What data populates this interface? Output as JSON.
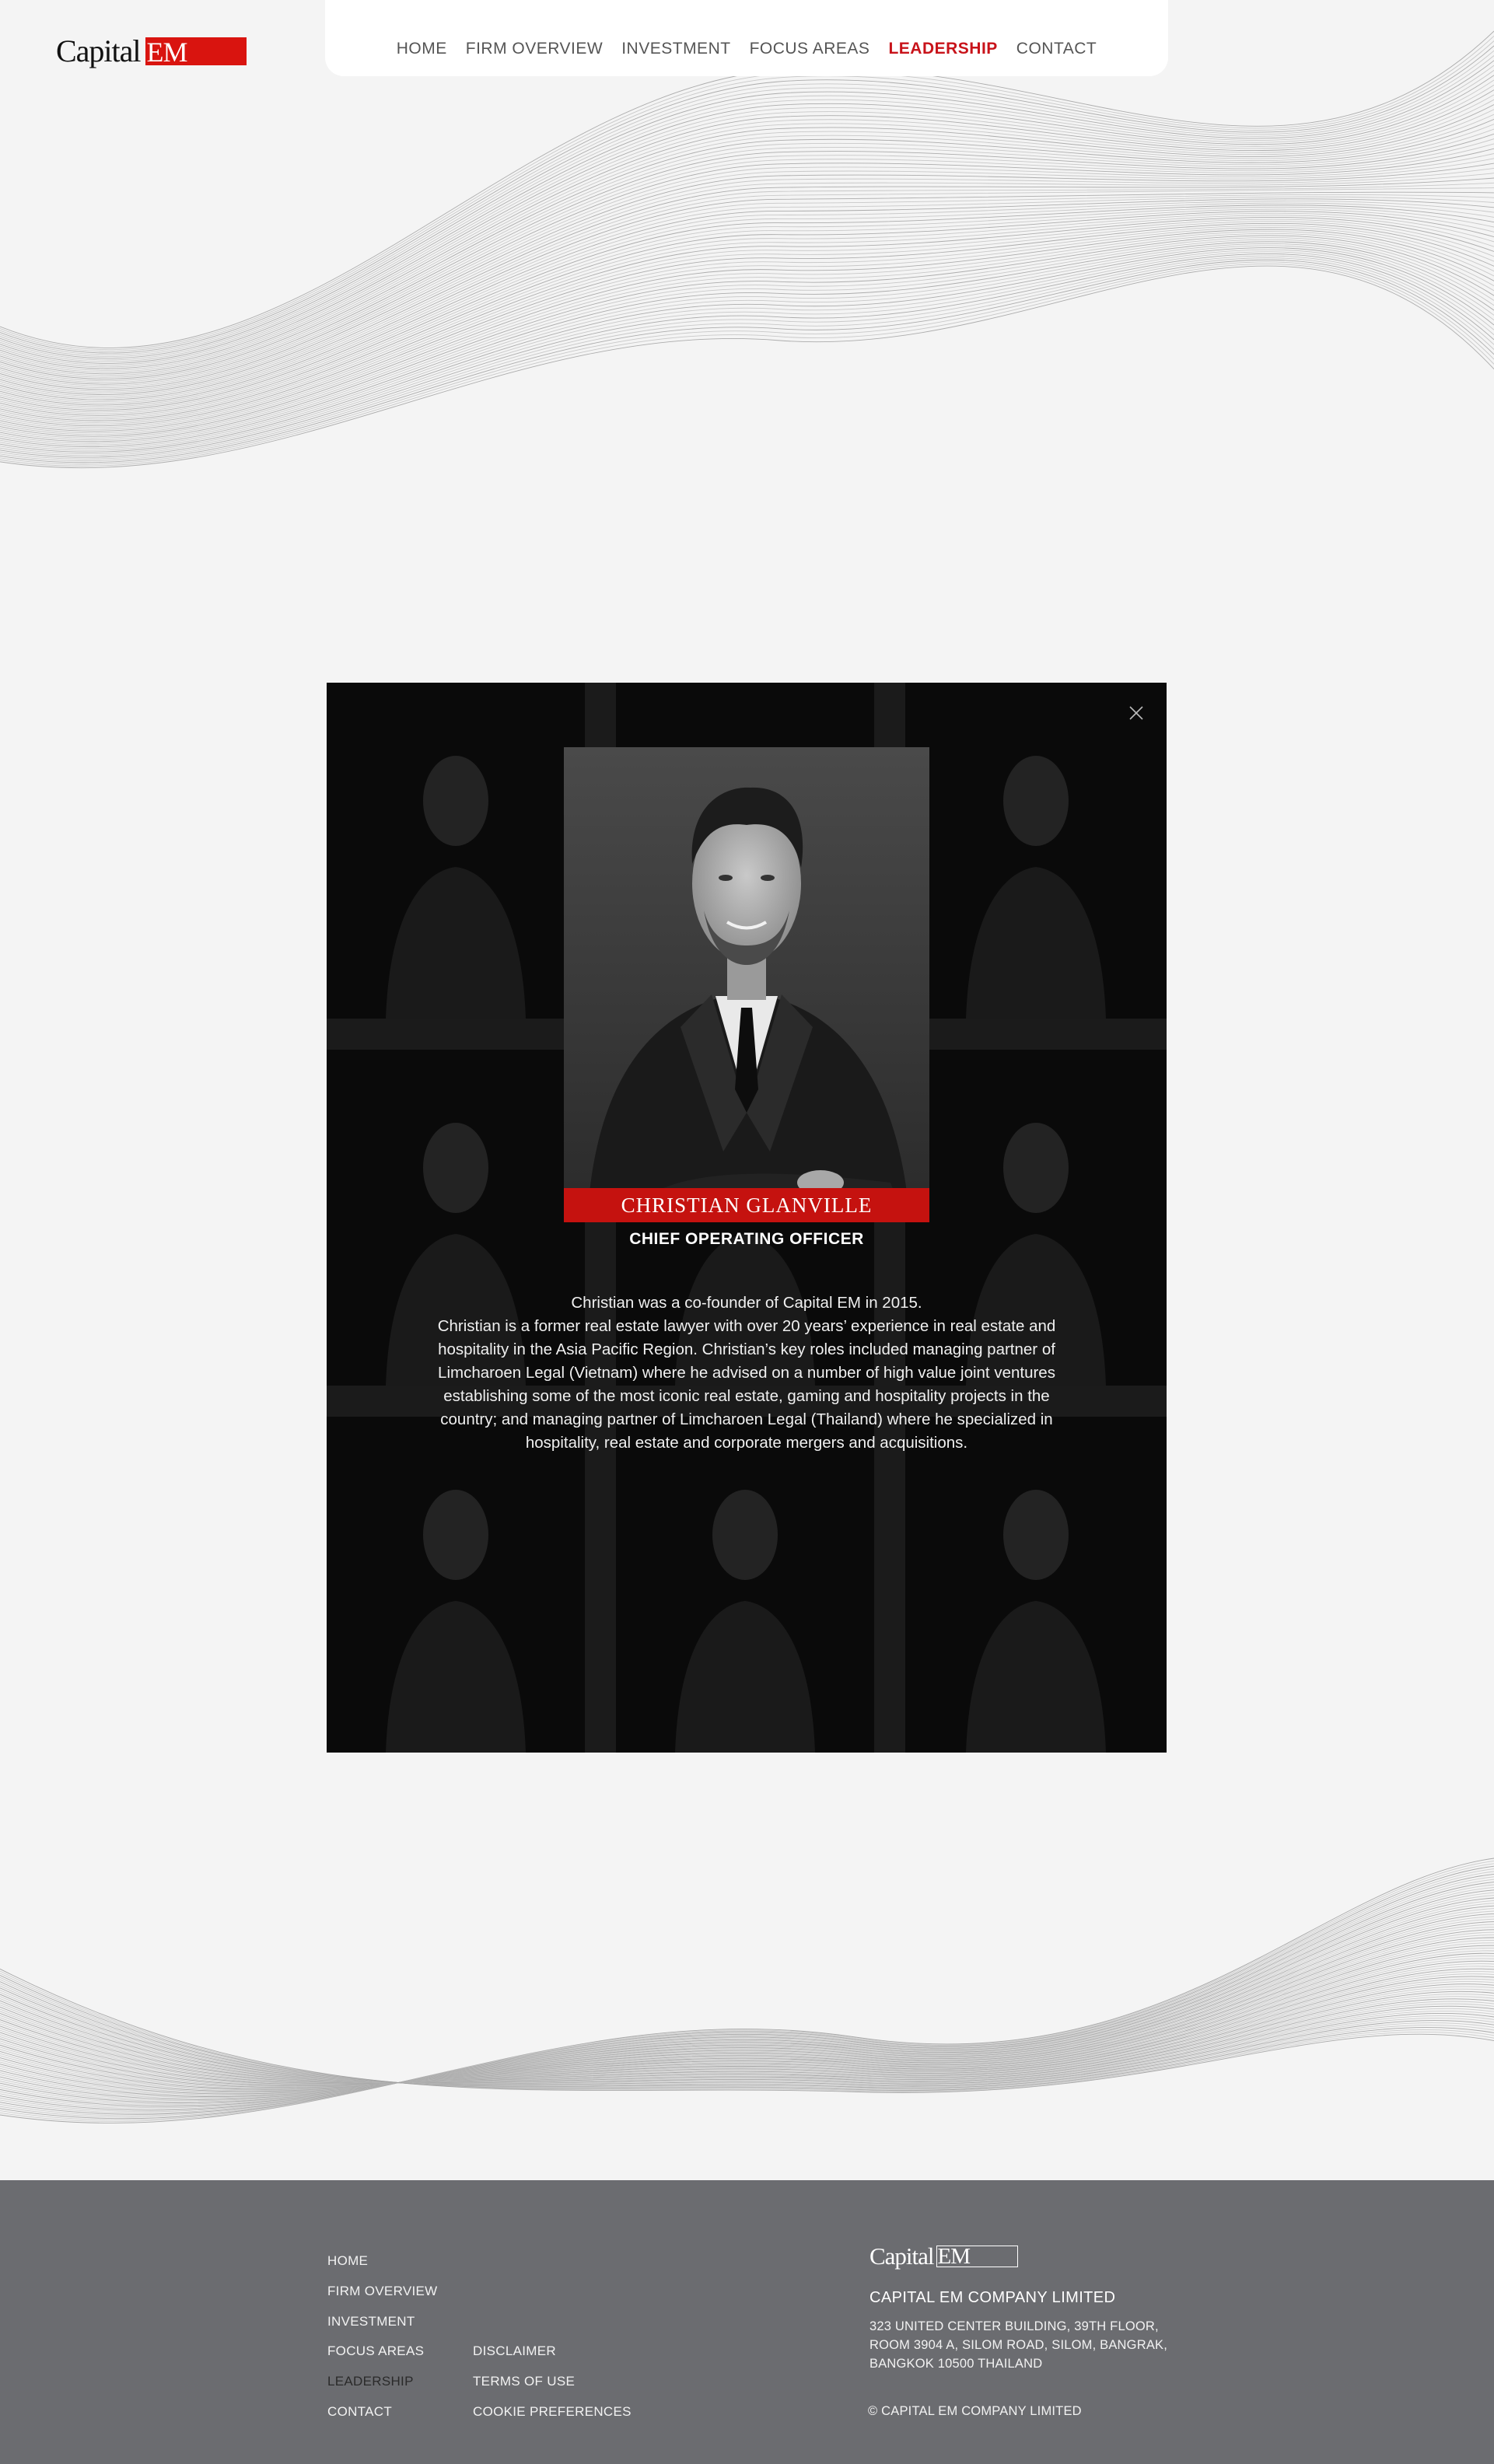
{
  "header": {
    "logo_word": "Capital",
    "logo_mark": "EM"
  },
  "nav": {
    "items": [
      {
        "label": "HOME"
      },
      {
        "label": "FIRM OVERVIEW"
      },
      {
        "label": "INVESTMENT"
      },
      {
        "label": "FOCUS AREAS"
      },
      {
        "label": "LEADERSHIP",
        "active": true
      },
      {
        "label": "CONTACT"
      }
    ]
  },
  "modal": {
    "close_icon": "close-icon",
    "name": "CHRISTIAN GLANVILLE",
    "role": "CHIEF OPERATING OFFICER",
    "bio": [
      "Christian was a co-founder of Capital EM in 2015.",
      "Christian is a former real estate lawyer with over 20 years’ experience in real estate and hospitality in the Asia Pacific Region. Christian’s key roles included managing partner of Limcharoen Legal (Vietnam) where he advised on a number of high value joint ventures establishing some of the most iconic real estate, gaming and hospitality projects in the country; and managing partner of Limcharoen Legal (Thailand) where he specialized in hospitality, real estate and corporate mergers and acquisitions."
    ]
  },
  "footer": {
    "nav_links": [
      "HOME",
      "FIRM OVERVIEW",
      "INVESTMENT",
      "FOCUS AREAS",
      "LEADERSHIP",
      "CONTACT"
    ],
    "legal_links": [
      "DISCLAIMER",
      "TERMS OF USE",
      "COOKIE PREFERENCES"
    ],
    "logo_word": "Capital",
    "logo_mark": "EM",
    "company": "CAPITAL EM COMPANY LIMITED",
    "address": "323 UNITED CENTER BUILDING, 39TH FLOOR, ROOM 3904 A, SILOM ROAD, SILOM, BANGRAK, BANGKOK 10500 THAILAND",
    "copyright": "© CAPITAL EM COMPANY LIMITED"
  },
  "colors": {
    "accent_red": "#c8131a",
    "footer_bg": "#6b6c70",
    "page_bg": "#f4f4f4"
  }
}
